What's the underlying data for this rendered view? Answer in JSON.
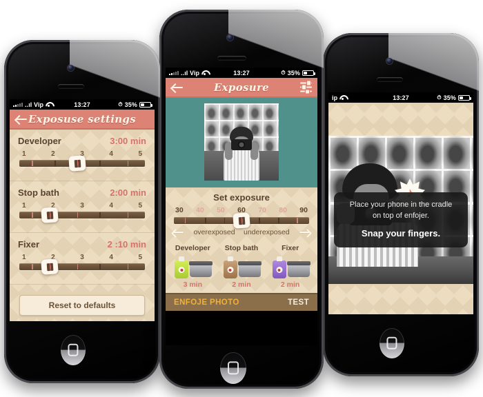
{
  "meta": {
    "colors": {
      "accent_red": "#dd8375",
      "paper": "#ecdcc0",
      "track_brown": "#6a5139",
      "teal": "#51918b",
      "tabbar_brown": "#8a6f4a",
      "tab_active_yellow": "#f0b13c",
      "value_red": "#d4726c",
      "label_brown": "#5a4330"
    }
  },
  "status_bar": {
    "carrier": "..ıl Vip",
    "carrier_short": "ip",
    "time": "13:27",
    "battery_percent": "35%",
    "wifi_icon": "wifi-icon",
    "signal_icon": "signal-bars-icon",
    "battery_icon": "battery-icon",
    "alarm_icon": "alarm-clock-icon"
  },
  "phone_left": {
    "nav": {
      "title": "Exposuse settings",
      "back_icon": "back-arrow-icon"
    },
    "settings_rows": [
      {
        "label": "Developer",
        "value": "3:00 min",
        "ticks": [
          "1",
          "2",
          "3",
          "4",
          "5"
        ],
        "knob_percent": 46
      },
      {
        "label": "Stop bath",
        "value": "2:00 min",
        "ticks": [
          "1",
          "2",
          "3",
          "4",
          "5"
        ],
        "knob_percent": 24
      },
      {
        "label": "Fixer",
        "value": "2 :10 min",
        "ticks": [
          "1",
          "2",
          "3",
          "4",
          "5"
        ],
        "knob_percent": 24
      }
    ],
    "reset_button": "Reset to defaults"
  },
  "phone_center": {
    "nav": {
      "title": "Exposure",
      "back_icon": "back-arrow-icon",
      "settings_icon": "sliders-icon"
    },
    "preview": {
      "alt": "black and white self portrait with camera in front of photo wall"
    },
    "exposure": {
      "title": "Set exposure",
      "ticks": [
        {
          "label": "30",
          "dim": false
        },
        {
          "label": "40",
          "dim": true
        },
        {
          "label": "50",
          "dim": true
        },
        {
          "label": "60",
          "dim": false
        },
        {
          "label": "70",
          "dim": true
        },
        {
          "label": "80",
          "dim": true
        },
        {
          "label": "90",
          "dim": false
        }
      ],
      "knob_percent": 50,
      "left_label": "overexposed",
      "right_label": "underexposed",
      "left_arrow_icon": "arrow-left-icon",
      "right_arrow_icon": "arrow-right-icon"
    },
    "chemicals": [
      {
        "name": "Developer",
        "time": "3 min",
        "bottle_color": "#c4df4a",
        "icon": "developer-bottle-icon"
      },
      {
        "name": "Stop bath",
        "time": "2 min",
        "bottle_color": "#b5906a",
        "icon": "stop-bath-bottle-icon"
      },
      {
        "name": "Fixer",
        "time": "2 min",
        "bottle_color": "#9b6fcf",
        "icon": "fixer-bottle-icon"
      }
    ],
    "tabbar": {
      "main": "ENFOJE PHOTO",
      "test": "TEST"
    }
  },
  "phone_right": {
    "tooltip": {
      "line1": "Place your phone in the cradle",
      "line2": "on top of enfojer.",
      "headline": "Snap your fingers.",
      "badge_icon": "music-note-burst-icon",
      "badge_glyph": "♪"
    }
  }
}
